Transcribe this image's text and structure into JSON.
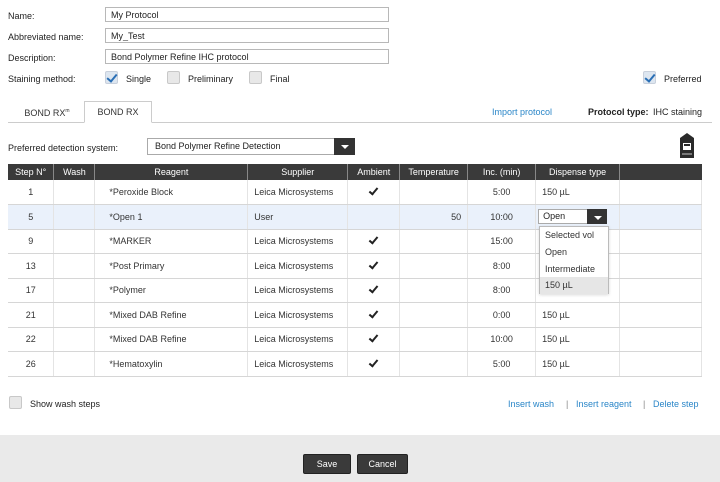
{
  "form": {
    "name_label": "Name:",
    "name_value": "My Protocol",
    "abbrev_label": "Abbreviated name:",
    "abbrev_value": "My_Test",
    "desc_label": "Description:",
    "desc_value": "Bond Polymer Refine IHC protocol",
    "staining_label": "Staining method:",
    "single_label": "Single",
    "preliminary_label": "Preliminary",
    "final_label": "Final",
    "preferred_label": "Preferred"
  },
  "tabs": [
    {
      "label": "BOND RX",
      "suffix": "m"
    },
    {
      "label": "BOND RX"
    }
  ],
  "header_right": {
    "import_label": "Import protocol",
    "protocol_type_label": "Protocol type:",
    "protocol_type_value": "IHC staining"
  },
  "detection": {
    "label": "Preferred detection system:",
    "value": "Bond Polymer Refine Detection"
  },
  "table": {
    "columns": [
      "Step N°",
      "Wash",
      "Reagent",
      "Supplier",
      "Ambient",
      "Temperature",
      "Inc. (min)",
      "Dispense type"
    ],
    "rows": [
      {
        "step": "1",
        "wash": "",
        "reagent": "*Peroxide Block",
        "supplier": "Leica Microsystems",
        "ambient": true,
        "temp": "",
        "inc": "5:00",
        "dispense": "150 µL"
      },
      {
        "step": "5",
        "wash": "",
        "reagent": "*Open 1",
        "supplier": "User",
        "ambient": false,
        "temp": "50",
        "inc": "10:00",
        "dispense": "Open"
      },
      {
        "step": "9",
        "wash": "",
        "reagent": "*MARKER",
        "supplier": "Leica Microsystems",
        "ambient": true,
        "temp": "",
        "inc": "15:00",
        "dispense": ""
      },
      {
        "step": "13",
        "wash": "",
        "reagent": "*Post Primary",
        "supplier": "Leica Microsystems",
        "ambient": true,
        "temp": "",
        "inc": "8:00",
        "dispense": ""
      },
      {
        "step": "17",
        "wash": "",
        "reagent": "*Polymer",
        "supplier": "Leica Microsystems",
        "ambient": true,
        "temp": "",
        "inc": "8:00",
        "dispense": ""
      },
      {
        "step": "21",
        "wash": "",
        "reagent": "*Mixed DAB Refine",
        "supplier": "Leica Microsystems",
        "ambient": true,
        "temp": "",
        "inc": "0:00",
        "dispense": "150 µL"
      },
      {
        "step": "22",
        "wash": "",
        "reagent": "*Mixed DAB Refine",
        "supplier": "Leica Microsystems",
        "ambient": true,
        "temp": "",
        "inc": "10:00",
        "dispense": "150 µL"
      },
      {
        "step": "26",
        "wash": "",
        "reagent": "*Hematoxylin",
        "supplier": "Leica Microsystems",
        "ambient": true,
        "temp": "",
        "inc": "5:00",
        "dispense": "150 µL"
      }
    ]
  },
  "dispense_dropdown": {
    "selected": "Open",
    "options": [
      "Selected vol",
      "Open",
      "Intermediate",
      "150 µL"
    ],
    "highlighted_index": 3
  },
  "bottom": {
    "show_wash_label": "Show wash steps",
    "insert_wash": "Insert wash",
    "insert_reagent": "Insert reagent",
    "delete_step": "Delete step",
    "separator": "|"
  },
  "footer": {
    "save_label": "Save",
    "cancel_label": "Cancel"
  },
  "colors": {
    "link": "#2a86c8",
    "header_bg": "#3a3a3a",
    "selected_row": "#eaf1fb",
    "selected_marker": "#3aa84a",
    "footer_bg": "#eaeaea"
  }
}
